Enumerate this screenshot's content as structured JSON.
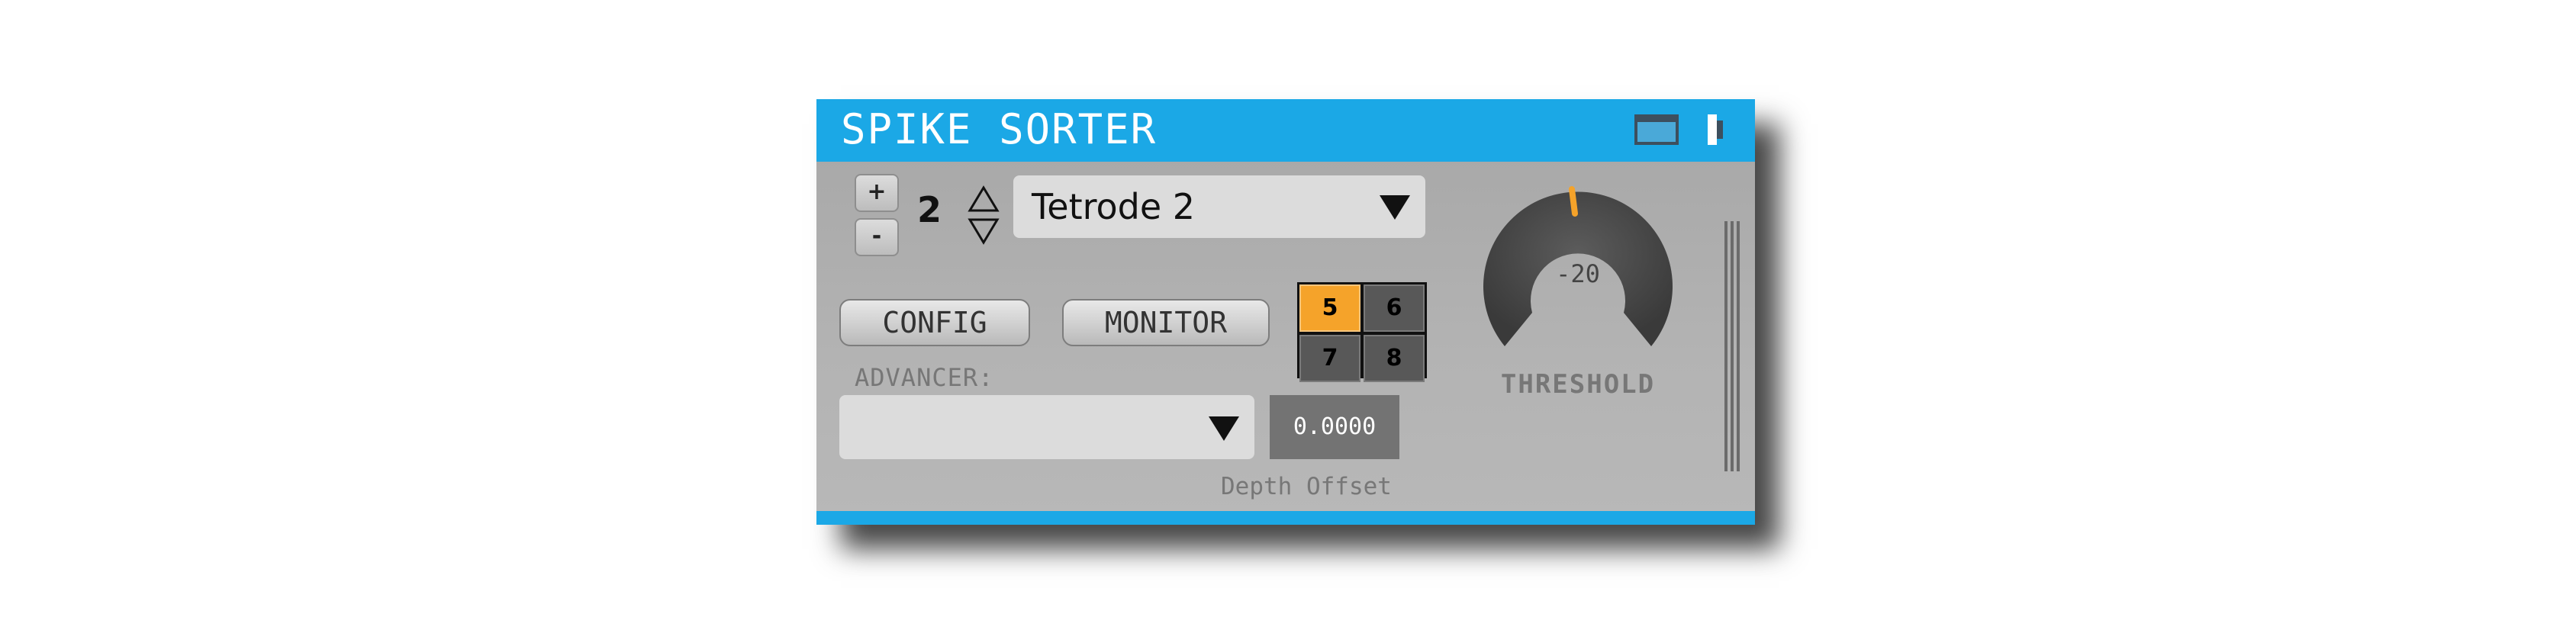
{
  "window": {
    "title": "SPIKE SORTER",
    "accent_color": "#1ba8e6",
    "window_icon": "window-maximize-icon",
    "pin_icon": "pin-icon"
  },
  "channel": {
    "add_label": "+",
    "remove_label": "-",
    "number": "2",
    "stepper_icon": "up-down-stepper-icon",
    "selected_electrode": "Tetrode 2"
  },
  "buttons": {
    "config_label": "CONFIG",
    "monitor_label": "MONITOR"
  },
  "channel_grid": {
    "cells": [
      {
        "label": "5",
        "active": true
      },
      {
        "label": "6",
        "active": false
      },
      {
        "label": "7",
        "active": false
      },
      {
        "label": "8",
        "active": false
      }
    ],
    "active_color": "#f5a32a"
  },
  "advancer": {
    "label": "ADVANCER:",
    "selected": "",
    "depth_value": "0.0000",
    "depth_label": "Depth Offset"
  },
  "threshold": {
    "value": "-20",
    "label": "THRESHOLD",
    "indicator_color": "#f5a32a"
  }
}
